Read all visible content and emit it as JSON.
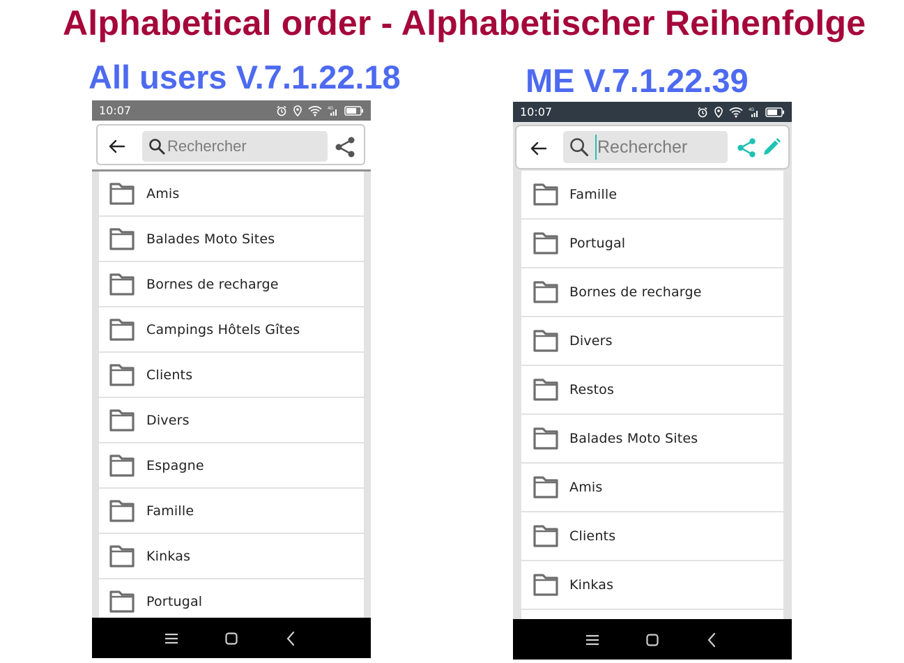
{
  "title": "Alphabetical order - Alphabetischer Reihenfolge",
  "colors": {
    "title": "#a5073b",
    "subtitle": "#4d6af0",
    "accent_teal": "#1fc2b1",
    "folder_gray": "#707070"
  },
  "left_panel": {
    "heading": "All users V.7.1.22.18",
    "status_time": "10:07",
    "search_placeholder": "Rechercher",
    "toolbar_icons": [
      "back-arrow-icon",
      "search-icon",
      "share-icon"
    ],
    "items": [
      {
        "label": "Amis"
      },
      {
        "label": "Balades Moto Sites"
      },
      {
        "label": "Bornes de recharge"
      },
      {
        "label": "Campings Hôtels Gîtes"
      },
      {
        "label": "Clients"
      },
      {
        "label": "Divers"
      },
      {
        "label": "Espagne"
      },
      {
        "label": "Famille"
      },
      {
        "label": "Kinkas"
      },
      {
        "label": "Portugal"
      }
    ]
  },
  "right_panel": {
    "heading": "ME V.7.1.22.39",
    "status_time": "10:07",
    "search_placeholder": "Rechercher",
    "toolbar_icons": [
      "back-arrow-icon",
      "search-icon",
      "share-icon",
      "edit-pencil-icon"
    ],
    "items": [
      {
        "label": "Famille"
      },
      {
        "label": "Portugal"
      },
      {
        "label": "Bornes de recharge"
      },
      {
        "label": "Divers"
      },
      {
        "label": "Restos"
      },
      {
        "label": "Balades Moto Sites"
      },
      {
        "label": "Amis"
      },
      {
        "label": "Clients"
      },
      {
        "label": "Kinkas"
      }
    ]
  },
  "navbar_icons": [
    "menu-icon",
    "home-icon",
    "back-icon"
  ]
}
